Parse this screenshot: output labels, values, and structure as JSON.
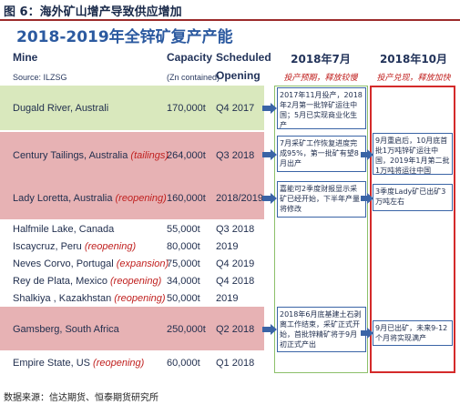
{
  "figure_title": "图 6：海外矿山增产导致供应增加",
  "slide_title": "2018-2019年全锌矿复产产能",
  "headers": {
    "mine": "Mine",
    "capacity": "Capacity",
    "scheduled": "Scheduled",
    "source": "Source: ILZSG",
    "zn_contained": "(Zn contained)",
    "opening": "Opening",
    "col_jul": "2018年7月",
    "col_oct": "2018年10月",
    "col_jul_sub": "投产预期，释放较慢",
    "col_oct_sub": "投产兑现，释放加快"
  },
  "rows": [
    {
      "mine": "Dugald River, Australi",
      "tag": "",
      "capacity": "170,000t",
      "opening": "Q4 2017"
    },
    {
      "mine": "Century Tailings, Australia ",
      "tag": "(tailings)",
      "capacity": "264,000t",
      "opening": "Q3 2018"
    },
    {
      "mine": "Lady Loretta, Australia ",
      "tag": "(reopening)",
      "capacity": "160,000t",
      "opening": "2018/2019"
    },
    {
      "mine": "Halfmile Lake, Canada",
      "tag": "",
      "capacity": "55,000t",
      "opening": "Q3 2018"
    },
    {
      "mine": "Iscaycruz, Peru ",
      "tag": "(reopening)",
      "capacity": "80,000t",
      "opening": "2019"
    },
    {
      "mine": "Neves Corvo, Portugal ",
      "tag": "(expansion)",
      "capacity": "75,000t",
      "opening": "Q4 2019"
    },
    {
      "mine": "Rey de Plata, Mexico ",
      "tag": "(reopening)",
      "capacity": "34,000t",
      "opening": "Q4 2018"
    },
    {
      "mine": "Shalkiya , Kazakhstan ",
      "tag": "(reopening)",
      "capacity": "50,000t",
      "opening": "2019"
    },
    {
      "mine": "Gamsberg, South Africa",
      "tag": "",
      "capacity": "250,000t",
      "opening": "Q2 2018"
    },
    {
      "mine": "Empire State, US ",
      "tag": "(reopening)",
      "capacity": "60,000t",
      "opening": "Q1 2018"
    }
  ],
  "notes_jul": [
    "2017年11月投产，2018年2月第一批锌矿运往中国；5月已实现商业化生产",
    "7月采矿工作恢复进度完成95%，第一批矿有望8月出产",
    "嘉能可2季度财报显示采矿已经开始，下半年产量将修改",
    "2018年6月底基建土石剥离工作结束，采矿正式开始，首批锌精矿将于9月初正式产出"
  ],
  "notes_oct": [
    "9月重启后，10月底首批1万吨锌矿运往中国，2019年1月第二批1万吨将运往中国",
    "3季度Lady矿已出矿3万吨左右",
    "9月已出矿，未来9-12个月将实现满产"
  ],
  "source_text": "数据来源：信达期货、恒泰期货研究所",
  "colors": {
    "green_band": "#d9e8bd",
    "pink_band": "#e7b2b4",
    "accent_red": "#c0201f",
    "note_border": "#3a64a6"
  }
}
